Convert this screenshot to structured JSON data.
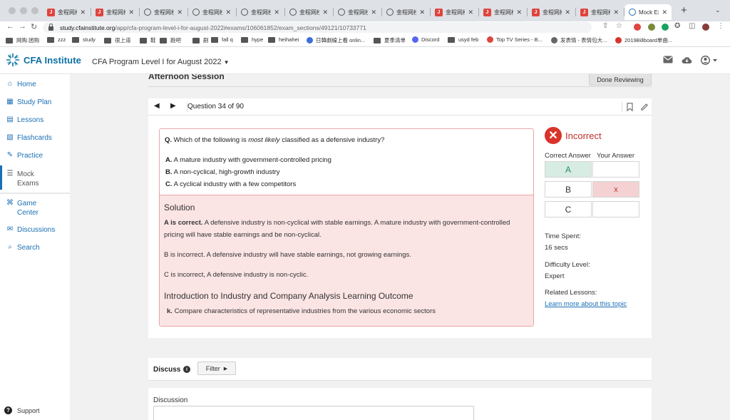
{
  "browser": {
    "tabs": [
      {
        "label": "金程网校",
        "icon": "red"
      },
      {
        "label": "金程网校",
        "icon": "red"
      },
      {
        "label": "金程网校",
        "icon": "globe"
      },
      {
        "label": "金程网校",
        "icon": "globe"
      },
      {
        "label": "金程网校",
        "icon": "globe"
      },
      {
        "label": "金程网校",
        "icon": "globe"
      },
      {
        "label": "金程网校",
        "icon": "globe"
      },
      {
        "label": "金程网校",
        "icon": "globe"
      },
      {
        "label": "金程网校",
        "icon": "red"
      },
      {
        "label": "金程网校",
        "icon": "red"
      },
      {
        "label": "金程网校",
        "icon": "red"
      },
      {
        "label": "金程网校",
        "icon": "red"
      },
      {
        "label": "Mock Ex",
        "icon": "globe-blue"
      }
    ],
    "url_host": "study.cfainstitute.org",
    "url_path": "/app/cfa-program-level-i-for-august-2022#exams/106061852/exam_sections/49121/10733771",
    "bookmarks": [
      {
        "label": "网购.团购",
        "icon": "folder"
      },
      {
        "label": "zzz",
        "icon": "folder"
      },
      {
        "label": "study",
        "icon": "folder"
      },
      {
        "label": "很上道",
        "icon": "folder"
      },
      {
        "label": "鞋",
        "icon": "folder"
      },
      {
        "label": "跑吧",
        "icon": "folder"
      },
      {
        "label": "剧",
        "icon": "folder"
      },
      {
        "label": "fall q",
        "icon": "folder"
      },
      {
        "label": "hype",
        "icon": "folder"
      },
      {
        "label": "heihahei",
        "icon": "folder"
      },
      {
        "label": "日韓劇線上看 onlin...",
        "icon": "blue"
      },
      {
        "label": "夏季清单",
        "icon": "folder"
      },
      {
        "label": "Discord",
        "icon": "discord"
      },
      {
        "label": "usyd feb",
        "icon": "folder"
      },
      {
        "label": "Top TV Series - B...",
        "icon": "tomato"
      },
      {
        "label": "发表情 - 表情包大...",
        "icon": "globe"
      },
      {
        "label": "2019Billboard单曲...",
        "icon": "red"
      }
    ]
  },
  "app": {
    "logo_text": "CFA Institute",
    "program": "CFA Program Level I for August 2022",
    "brand_color": "#0b6fa4"
  },
  "sidebar": {
    "items": [
      {
        "label": "Home",
        "icon": "home-icon"
      },
      {
        "label": "Study Plan",
        "icon": "calendar-icon"
      },
      {
        "label": "Lessons",
        "icon": "book-icon"
      },
      {
        "label": "Flashcards",
        "icon": "cards-icon"
      },
      {
        "label": "Practice",
        "icon": "pencil-icon"
      },
      {
        "label": "Mock",
        "label2": "Exams",
        "icon": "exam-icon",
        "active": true
      },
      {
        "label": "Game",
        "label2": "Center",
        "icon": "gamepad-icon"
      },
      {
        "label": "Discussions",
        "icon": "chat-icon"
      },
      {
        "label": "Search",
        "icon": "search-icon"
      }
    ],
    "support_label": "Support"
  },
  "session": {
    "title": "Afternoon Session",
    "done_label": "Done Reviewing"
  },
  "question": {
    "counter": "Question 34 of 90",
    "prefix": "Q.",
    "text_before": "Which of the following is",
    "text_emph": "most likely",
    "text_after": "classified as a defensive industry?",
    "choices": [
      {
        "key": "A.",
        "text": "A mature industry with government-controlled pricing"
      },
      {
        "key": "B.",
        "text": "A non-cyclical, high-growth industry"
      },
      {
        "key": "C.",
        "text": "A cyclical industry with a few competitors"
      }
    ]
  },
  "solution": {
    "heading": "Solution",
    "p1_bold": "A is correct.",
    "p1": "A defensive industry is non-cyclical with stable earnings. A mature industry with government-controlled pricing will have stable earnings and be non-cyclical.",
    "p2": "B is incorrect. A defensive industry will have stable earnings, not growing earnings.",
    "p3": "C is incorrect, A defensive industry is non-cyclic.",
    "lo_heading": "Introduction to Industry and Company Analysis Learning Outcome",
    "lo_key": "k.",
    "lo_text": "Compare characteristics of representative industries from the various economic sectors"
  },
  "result": {
    "status": "Incorrect",
    "status_color": "#c0302a",
    "col_correct": "Correct Answer",
    "col_yours": "Your Answer",
    "rows": [
      {
        "correct": "A",
        "yours": "",
        "state": "correct"
      },
      {
        "correct": "B",
        "yours": "x",
        "state": "wrong"
      },
      {
        "correct": "C",
        "yours": "",
        "state": "none"
      }
    ],
    "time_label": "Time Spent:",
    "time_value": "16 secs",
    "difficulty_label": "Difficulty Level:",
    "difficulty_value": "Expert",
    "related_label": "Related Lessons:",
    "related_link": "Learn more about this topic"
  },
  "discuss": {
    "title": "Discuss",
    "filter_label": "Filter",
    "area_label": "Discussion"
  }
}
